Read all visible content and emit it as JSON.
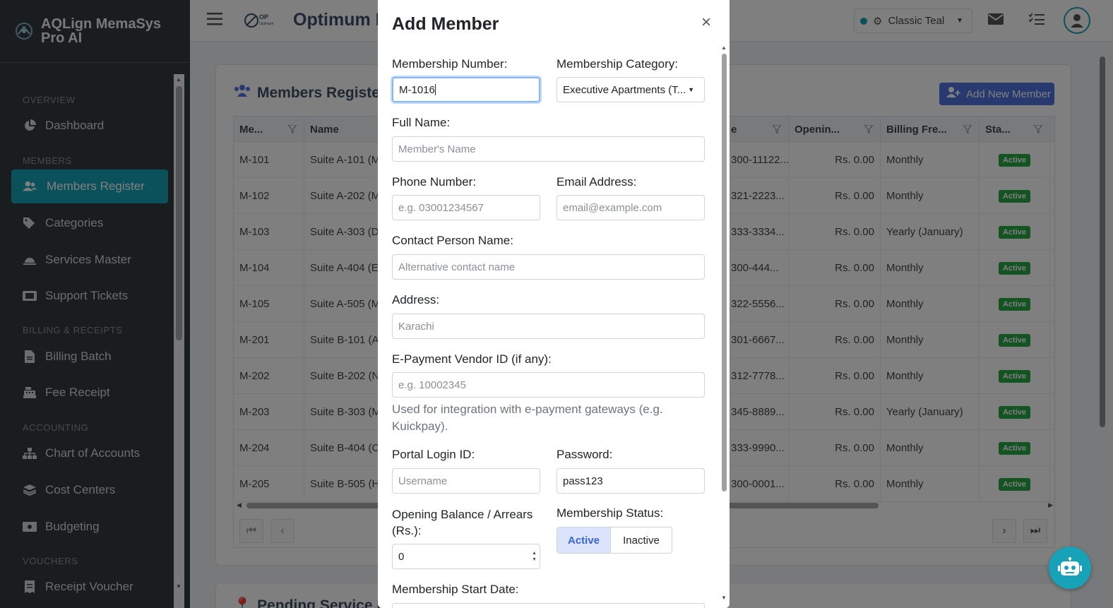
{
  "brand": {
    "name": "AQLign MemaSys Pro AI"
  },
  "sidebar": {
    "sections": [
      "OVERVIEW",
      "MEMBERS",
      "BILLING & RECEIPTS",
      "ACCOUNTING",
      "VOUCHERS"
    ],
    "items": [
      {
        "label": "Dashboard",
        "icon": "chart-pie-icon"
      },
      {
        "label": "Members Register",
        "icon": "users-icon",
        "active": true
      },
      {
        "label": "Categories",
        "icon": "tags-icon"
      },
      {
        "label": "Services Master",
        "icon": "service-bell-icon"
      },
      {
        "label": "Support Tickets",
        "icon": "ticket-icon"
      },
      {
        "label": "Billing Batch",
        "icon": "file-invoice-icon"
      },
      {
        "label": "Fee Receipt",
        "icon": "cash-register-icon"
      },
      {
        "label": "Chart of Accounts",
        "icon": "sitemap-icon"
      },
      {
        "label": "Cost Centers",
        "icon": "layers-icon"
      },
      {
        "label": "Budgeting",
        "icon": "money-bill-icon"
      },
      {
        "label": "Receipt Voucher",
        "icon": "receipt-icon"
      }
    ]
  },
  "header": {
    "title": "Optimum R",
    "logo_text": "OP Optimum Residency",
    "theme": "Classic Teal",
    "colors": {
      "accent": "#17a2b8",
      "primary": "#4e73df"
    }
  },
  "card": {
    "title": "Members Register",
    "add_button": "Add New Member"
  },
  "table": {
    "columns": [
      "Me...",
      "Name",
      "e",
      "Openin...",
      "Billing Fre...",
      "Sta..."
    ],
    "rows": [
      {
        "no": "M-101",
        "name": "Suite A-101 (Mr",
        "phone": "300-11122...",
        "opening": "Rs. 0.00",
        "billing": "Monthly",
        "status": "Active"
      },
      {
        "no": "M-102",
        "name": "Suite A-202 (M",
        "phone": "321-2223...",
        "opening": "Rs. 0.00",
        "billing": "Monthly",
        "status": "Active"
      },
      {
        "no": "M-103",
        "name": "Suite A-303 (D",
        "phone": "333-3334...",
        "opening": "Rs. 0.00",
        "billing": "Yearly (January)",
        "status": "Active"
      },
      {
        "no": "M-104",
        "name": "Suite A-404 (E",
        "phone": "300-444...",
        "opening": "Rs. 0.00",
        "billing": "Monthly",
        "status": "Active"
      },
      {
        "no": "M-105",
        "name": "Suite A-505 (M",
        "phone": "322-5556...",
        "opening": "Rs. 0.00",
        "billing": "Monthly",
        "status": "Active"
      },
      {
        "no": "M-201",
        "name": "Suite B-101 (Ap",
        "phone": "301-6667...",
        "opening": "Rs. 0.00",
        "billing": "Monthly",
        "status": "Active"
      },
      {
        "no": "M-202",
        "name": "Suite B-202 (N",
        "phone": "312-7778...",
        "opening": "Rs. 0.00",
        "billing": "Monthly",
        "status": "Active"
      },
      {
        "no": "M-203",
        "name": "Suite B-303 (M",
        "phone": "345-8889...",
        "opening": "Rs. 0.00",
        "billing": "Yearly (January)",
        "status": "Active"
      },
      {
        "no": "M-204",
        "name": "Suite B-404 (O",
        "phone": "333-9990...",
        "opening": "Rs. 0.00",
        "billing": "Monthly",
        "status": "Active"
      },
      {
        "no": "M-205",
        "name": "Suite B-505 (H",
        "phone": "300-0001...",
        "opening": "Rs. 0.00",
        "billing": "Monthly",
        "status": "Active"
      }
    ]
  },
  "second_card": {
    "title": "Pending Service R"
  },
  "modal": {
    "title": "Add Member",
    "close": "×",
    "membership_number": {
      "label": "Membership Number:",
      "value": "M-1016"
    },
    "category": {
      "label": "Membership Category:",
      "value": "Executive Apartments (T..."
    },
    "full_name": {
      "label": "Full Name:",
      "placeholder": "Member's Name"
    },
    "phone": {
      "label": "Phone Number:",
      "placeholder": "e.g. 03001234567"
    },
    "email": {
      "label": "Email Address:",
      "placeholder": "email@example.com"
    },
    "contact": {
      "label": "Contact Person Name:",
      "placeholder": "Alternative contact name"
    },
    "address": {
      "label": "Address:",
      "placeholder": "Karachi"
    },
    "vendor": {
      "label": "E-Payment Vendor ID (if any):",
      "placeholder": "e.g. 10002345",
      "help": "Used for integration with e-payment gateways (e.g. Kuickpay)."
    },
    "login": {
      "label": "Portal Login ID:",
      "placeholder": "Username"
    },
    "password": {
      "label": "Password:",
      "value": "pass123"
    },
    "opening": {
      "label": "Opening Balance / Arrears (Rs.):",
      "value": "0"
    },
    "status": {
      "label": "Membership Status:",
      "active": "Active",
      "inactive": "Inactive"
    },
    "start_date": {
      "label": "Membership Start Date:"
    }
  }
}
